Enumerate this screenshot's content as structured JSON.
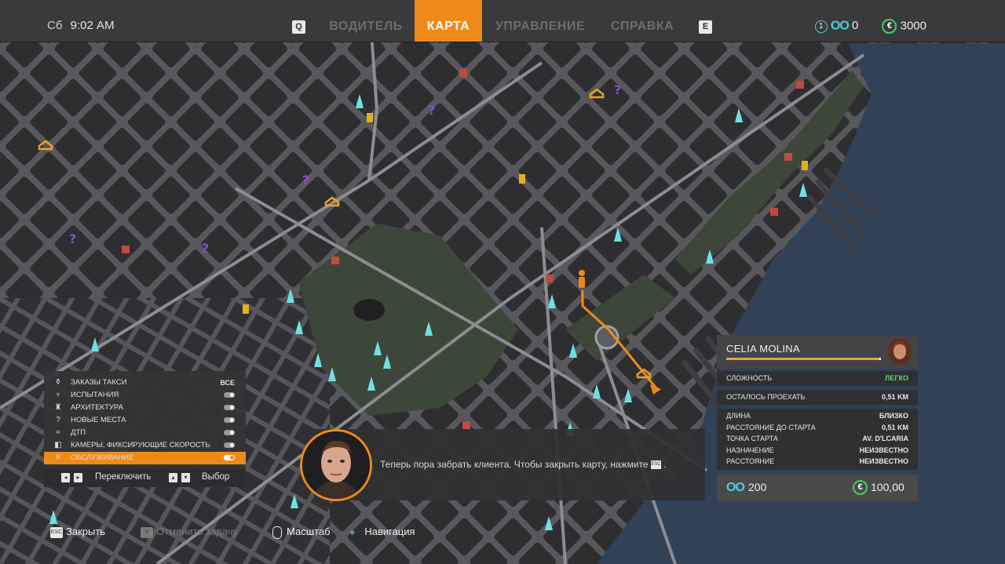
{
  "header": {
    "day": "Сб",
    "time": "9:02 AM",
    "left_key": "Q",
    "right_key": "E",
    "tabs": [
      {
        "label": "ВОДИТЕЛЬ",
        "active": false
      },
      {
        "label": "КАРТА",
        "active": true
      },
      {
        "label": "УПРАВЛЕНИЕ",
        "active": false
      },
      {
        "label": "СПРАВКА",
        "active": false
      }
    ],
    "level": "1",
    "tokens": "0",
    "money": "3000",
    "accent_color": "#ef8a1a"
  },
  "legend": {
    "items": [
      {
        "icon": "taxi-order-icon",
        "glyph": "⚱",
        "label": "Заказы такси",
        "value": "ВСЕ"
      },
      {
        "icon": "trophy-icon",
        "glyph": "🏆",
        "label": "Испытания",
        "value": ""
      },
      {
        "icon": "monument-icon",
        "glyph": "♜",
        "label": "Архитектура",
        "value": ""
      },
      {
        "icon": "question-icon",
        "glyph": "?",
        "label": "Новые места",
        "value": ""
      },
      {
        "icon": "crash-icon",
        "glyph": "≈",
        "label": "ДТП",
        "value": ""
      },
      {
        "icon": "speed-camera-icon",
        "glyph": "◧",
        "label": "Камеры, фиксирующие скорость",
        "value": ""
      },
      {
        "icon": "wrench-icon",
        "glyph": "✕",
        "label": "Обслуживание",
        "value": ""
      }
    ],
    "selected_index": 6,
    "footer_switch": "Переключить",
    "footer_select": "Выбор"
  },
  "dialogue": {
    "text": "Теперь пора забрать клиента. Чтобы закрыть карту, нажмите",
    "key": "ESC"
  },
  "client": {
    "name": "CELIA MOLINA",
    "difficulty_label": "Сложность",
    "difficulty_value": "Легко",
    "remaining_label": "Осталось проехать",
    "remaining_value": "0,51 KM",
    "details": [
      {
        "label": "ДЛИНА",
        "value": "БЛИЗКО"
      },
      {
        "label": "РАССТОЯНИЕ ДО СТАРТА",
        "value": "0,51 KM"
      },
      {
        "label": "ТОЧКА СТАРТА",
        "value": "AV. D'LCARIA"
      },
      {
        "label": "НАЗНАЧЕНИЕ",
        "value": "НЕИЗВЕСТНО"
      },
      {
        "label": "РАССТОЯНИЕ",
        "value": "НЕИЗВЕСТНО"
      }
    ],
    "reward_tokens": "200",
    "reward_money": "100,00",
    "easy_color": "#5ddc5d"
  },
  "hints": [
    {
      "key": "ESC",
      "label": "Закрыть",
      "enabled": true
    },
    {
      "key": "V",
      "label": "Отменить задачу",
      "enabled": false
    },
    {
      "key": "🖱",
      "label": "Масштаб",
      "enabled": true
    },
    {
      "key": "⌖",
      "label": "Навигация",
      "enabled": true
    }
  ]
}
